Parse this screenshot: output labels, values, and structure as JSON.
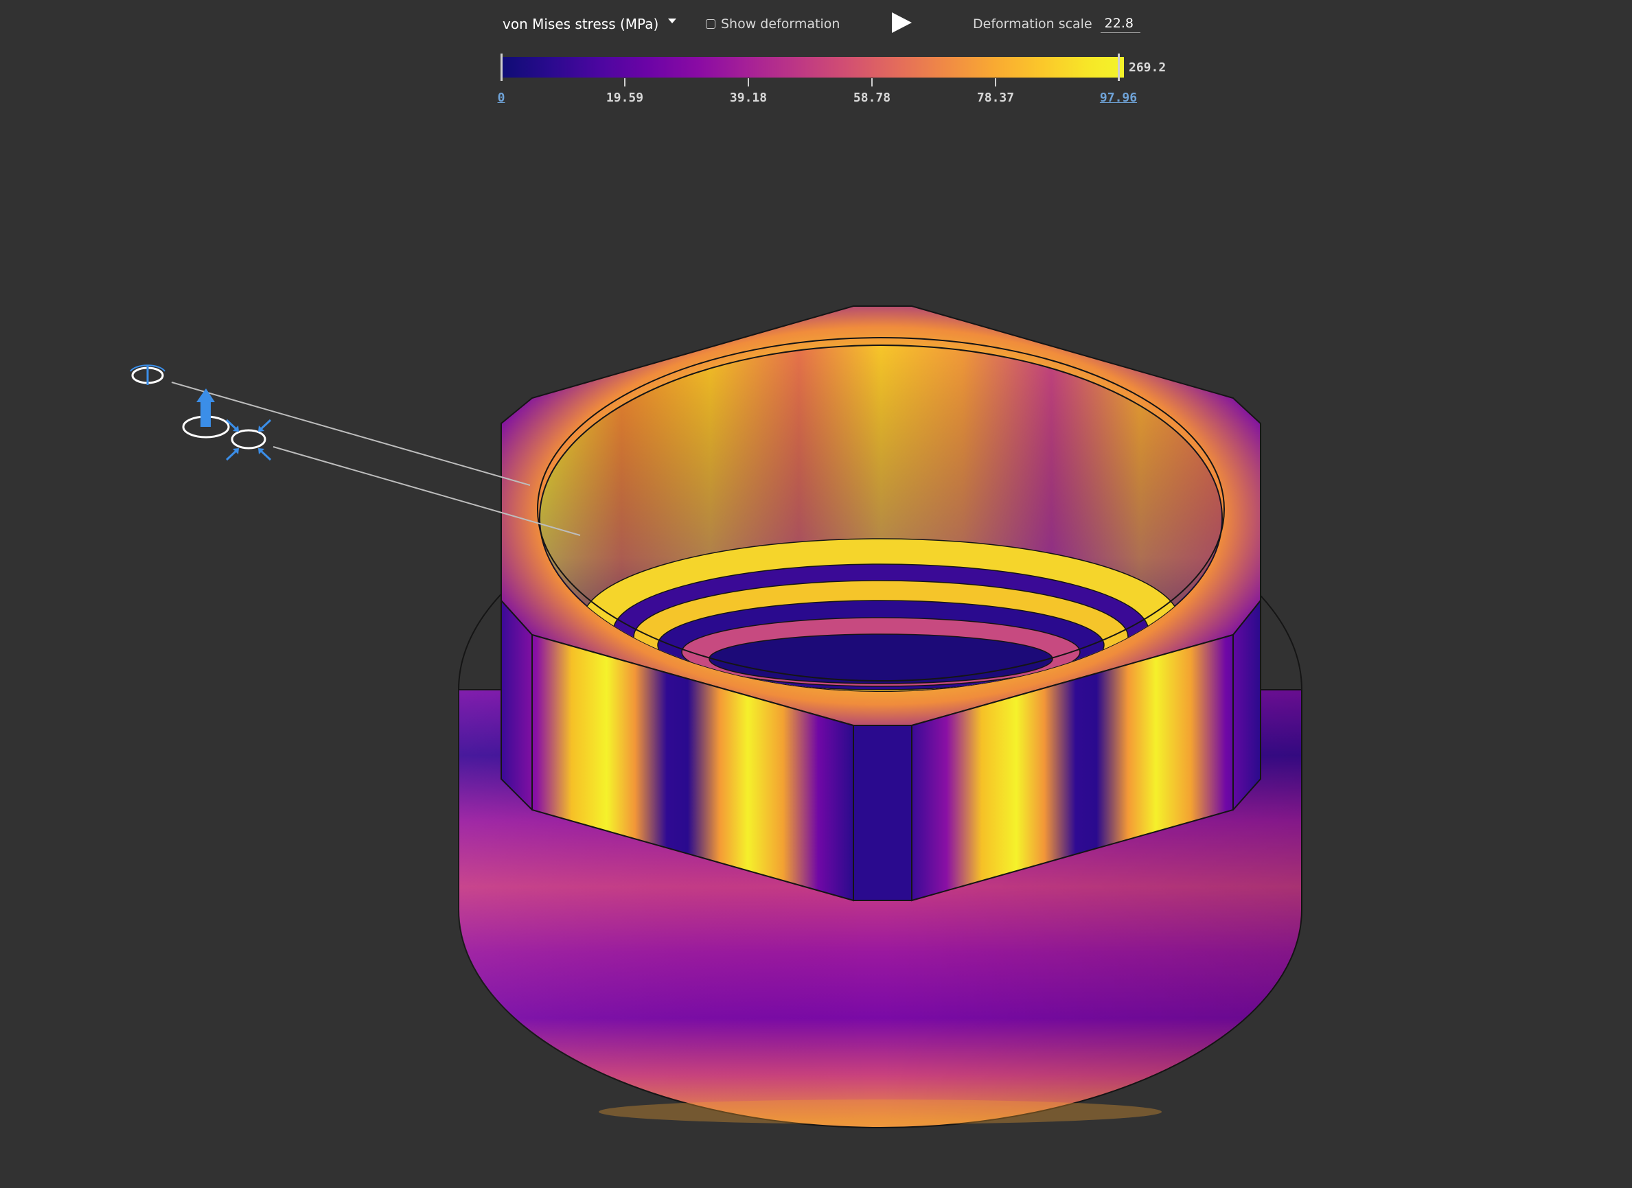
{
  "toolbar": {
    "result_type": "von Mises stress (MPa)",
    "show_deformation_label": "Show deformation",
    "deformation_scale_label": "Deformation scale",
    "deformation_scale_value": "22.8"
  },
  "legend": {
    "min_label": "0",
    "ticks": [
      "19.59",
      "39.18",
      "58.78",
      "78.37"
    ],
    "range_max_label": "97.96",
    "max_value": "269.2"
  },
  "icons": {
    "play": "play-icon",
    "fixed_constraint": "fixed-constraint-icon",
    "load": "load-arrow-icon",
    "pressure": "pressure-icon",
    "dropdown": "chevron-down-icon"
  },
  "colors": {
    "background": "#323232",
    "map_low": "#0e0d74",
    "map_mid": "#bd3785",
    "map_high": "#f4f22a",
    "icon_blue": "#3b8ee8"
  }
}
